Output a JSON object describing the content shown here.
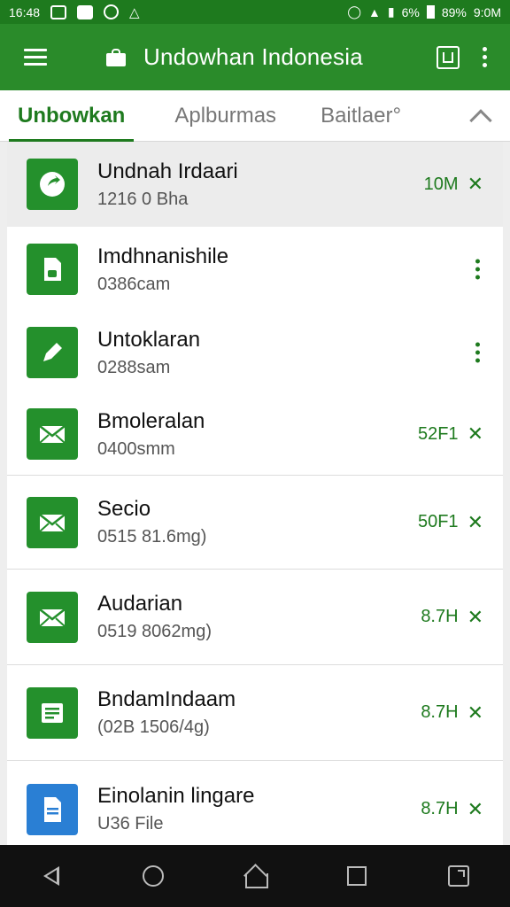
{
  "status_bar": {
    "time": "16:48",
    "battery_small": "6%",
    "battery": "89%",
    "clock": "9:0M"
  },
  "app_bar": {
    "title": "Undowhan Indonesia"
  },
  "tabs": [
    {
      "label": "Unbowkan",
      "active": true
    },
    {
      "label": "Aplburmas",
      "active": false
    },
    {
      "label": "Baitlaer°",
      "active": false
    }
  ],
  "files": [
    {
      "name": "Undnah Irdaari",
      "meta": "1216 0 Bha",
      "size": "10M",
      "action": "close",
      "icon": "share-icon",
      "color": "#24902c"
    },
    {
      "name": "Imdhnanishile",
      "meta": "0386cam",
      "size": "",
      "action": "more",
      "icon": "file-icon",
      "color": "#24902c"
    },
    {
      "name": "Untoklaran",
      "meta": "0288sam",
      "size": "",
      "action": "more",
      "icon": "pencil-icon",
      "color": "#24902c"
    },
    {
      "name": "Bmoleralan",
      "meta": "0400smm",
      "size": "52F1",
      "action": "close",
      "icon": "mail-icon",
      "color": "#24902c"
    },
    {
      "name": "Secio",
      "meta": "0515 81.6mg)",
      "size": "50F1",
      "action": "close",
      "icon": "mail-icon",
      "color": "#24902c"
    },
    {
      "name": "Audarian",
      "meta": "0519 8062mg)",
      "size": "8.7H",
      "action": "close",
      "icon": "mail-icon",
      "color": "#24902c"
    },
    {
      "name": "BndamIndaam",
      "meta": "(02B 1506/4g)",
      "size": "8.7H",
      "action": "close",
      "icon": "sheet-icon",
      "color": "#24902c"
    },
    {
      "name": "Einolanin lingare",
      "meta": "U36 File",
      "size": "8.7H",
      "action": "close",
      "icon": "doc-icon",
      "color": "#2a7fd4"
    }
  ],
  "colors": {
    "primary": "#2a8b2a",
    "primary_dark": "#1e7a1e",
    "accent_green": "#24902c",
    "accent_blue": "#2a7fd4"
  }
}
